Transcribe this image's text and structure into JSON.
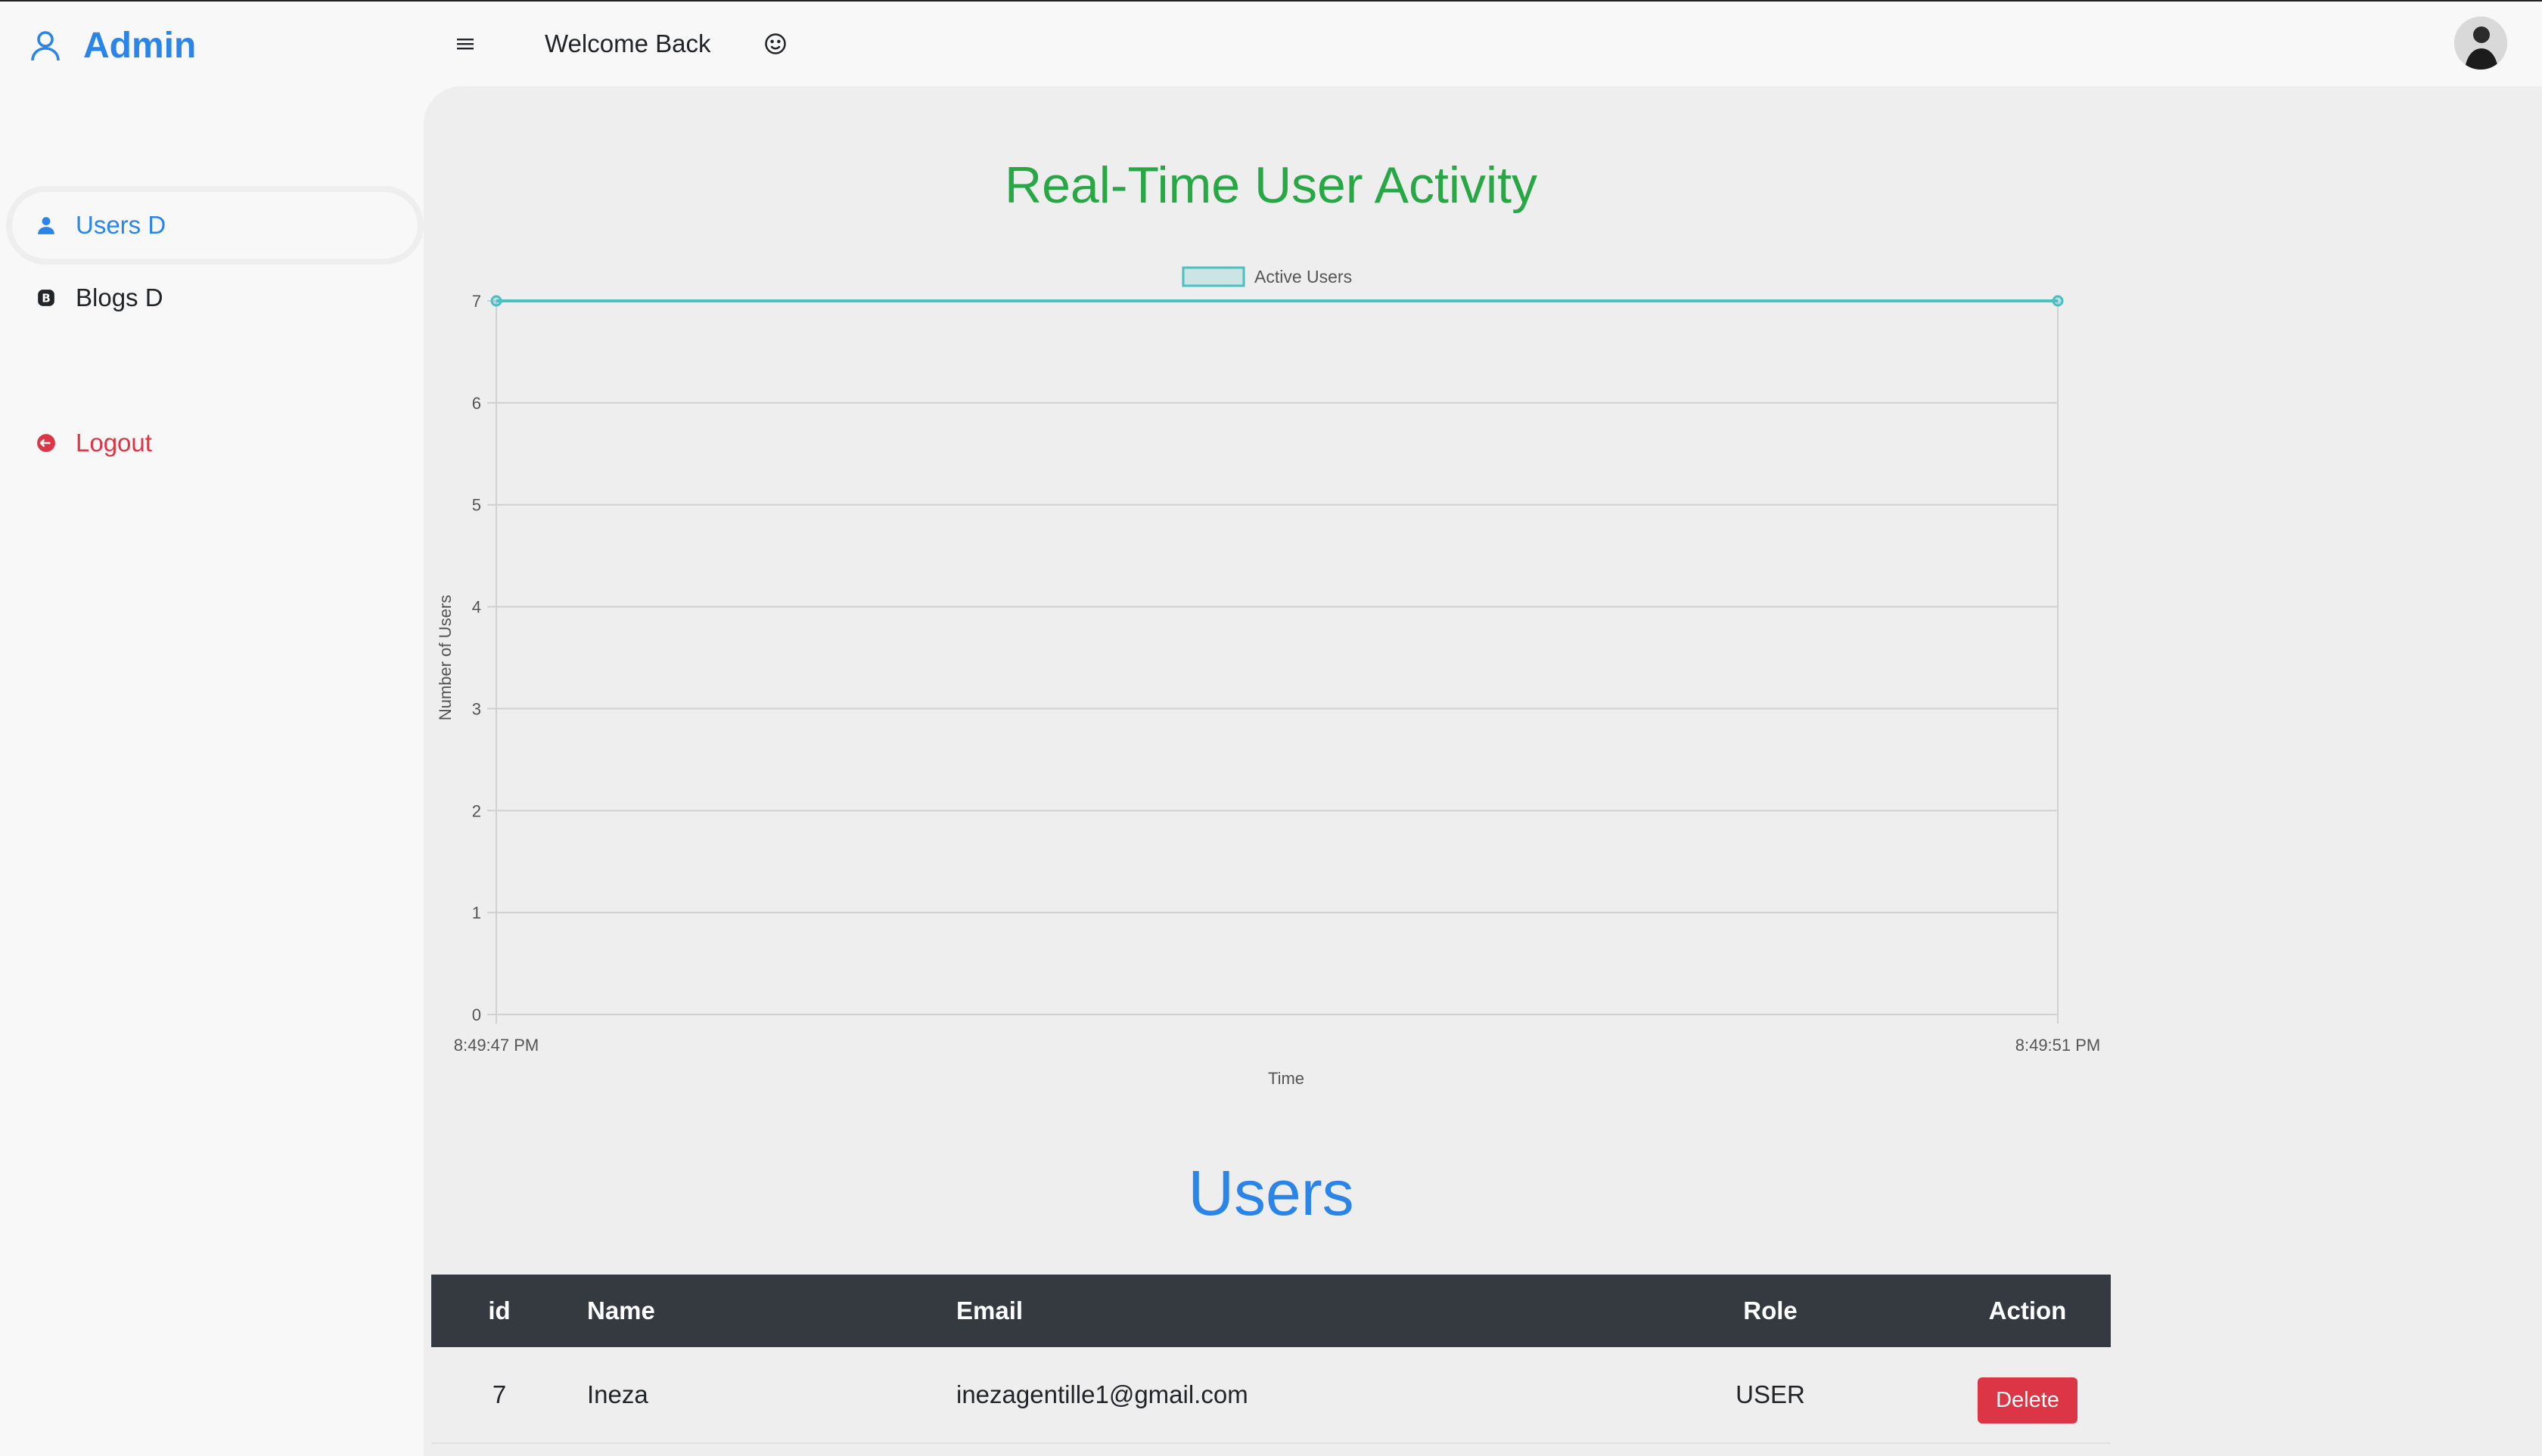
{
  "app": {
    "brand": "Admin"
  },
  "header": {
    "welcome": "Welcome Back"
  },
  "sidebar": {
    "items": [
      {
        "label": "Users D",
        "icon": "user-icon",
        "active": true
      },
      {
        "label": "Blogs D",
        "icon": "blog-icon"
      },
      {
        "label": "Logout",
        "icon": "logout-icon"
      }
    ]
  },
  "chart_title": "Real-Time User Activity",
  "chart_data": {
    "type": "line",
    "title": "Real-Time User Activity",
    "xlabel": "Time",
    "ylabel": "Number of Users",
    "x": [
      "8:49:47 PM",
      "8:49:51 PM"
    ],
    "series": [
      {
        "name": "Active Users",
        "values": [
          7,
          7
        ]
      }
    ],
    "ylim": [
      0,
      7
    ],
    "yticks": [
      "0",
      "1",
      "2",
      "3",
      "4",
      "5",
      "6",
      "7"
    ],
    "grid": true,
    "legend": "top-center",
    "colors": {
      "line": "#4bc0c0"
    }
  },
  "users_title": "Users",
  "table": {
    "headers": [
      "id",
      "Name",
      "Email",
      "Role",
      "Action"
    ],
    "rows": [
      {
        "id": "7",
        "name": "Ineza",
        "email": "inezagentille1@gmail.com",
        "role": "USER",
        "action": "Delete"
      }
    ]
  },
  "colors": {
    "accent": "#2b84e8",
    "success": "#28a745",
    "danger": "#dc3545",
    "table_header": "#343a40"
  }
}
